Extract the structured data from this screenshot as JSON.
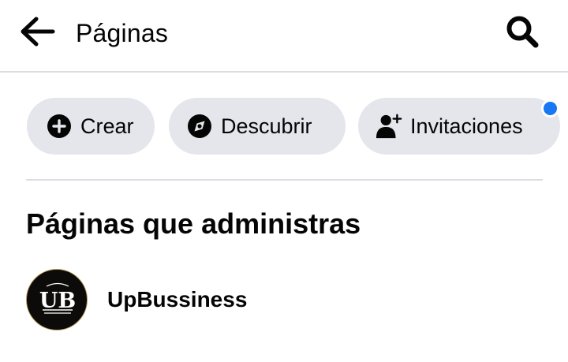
{
  "header": {
    "title": "Páginas",
    "back_icon": "arrow-left-icon",
    "search_icon": "search-icon"
  },
  "chips": [
    {
      "label": "Crear",
      "icon": "plus-circle-icon"
    },
    {
      "label": "Descubrir",
      "icon": "compass-icon"
    },
    {
      "label": "Invitaciones",
      "icon": "add-person-icon",
      "has_notification": true
    }
  ],
  "section": {
    "title": "Páginas que administras"
  },
  "pages": [
    {
      "name": "UpBussiness",
      "avatar_text": "UB"
    }
  ],
  "colors": {
    "chip_background": "#e4e6eb",
    "notification_dot": "#1877f2",
    "divider": "#dadde1",
    "text": "#050505"
  }
}
